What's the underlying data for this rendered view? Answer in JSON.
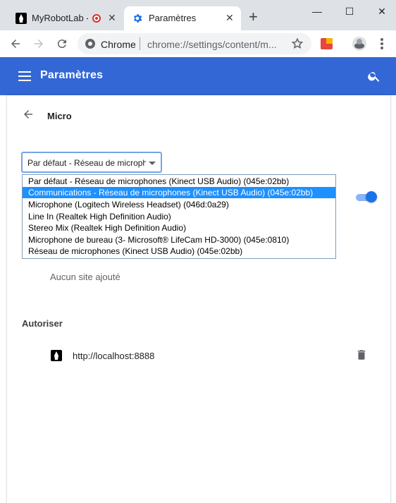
{
  "browser": {
    "tabs": [
      {
        "title": "MyRobotLab -",
        "icon": "myrobotlab-icon",
        "recording": true
      },
      {
        "title": "Paramètres",
        "icon": "settings-gear-icon",
        "active": true
      }
    ],
    "new_tab_label": "+",
    "window_controls": {
      "minimize": "—",
      "maximize": "☐",
      "close": "✕"
    },
    "omnibox": {
      "scheme_label": "Chrome",
      "url": "chrome://settings/content/m..."
    }
  },
  "settings": {
    "header_title": "Paramètres",
    "subpage_title": "Micro",
    "selected_device": "Par défaut - Réseau de micropho",
    "device_options": [
      "Par défaut - Réseau de microphones (Kinect USB Audio) (045e:02bb)",
      "Communications - Réseau de microphones (Kinect USB Audio) (045e:02bb)",
      "Microphone (Logitech Wireless Headset) (046d:0a29)",
      "Line In (Realtek High Definition Audio)",
      "Stereo Mix (Realtek High Definition Audio)",
      "Microphone de bureau (3- Microsoft® LifeCam HD-3000) (045e:0810)",
      "Réseau de microphones (Kinect USB Audio) (045e:02bb)"
    ],
    "highlighted_option_index": 1,
    "ask_toggle_on": true,
    "block_empty_text": "Aucun site ajouté",
    "allow_heading": "Autoriser",
    "allowed_site": "http://localhost:8888"
  },
  "colors": {
    "header_blue": "#3367d6",
    "toggle_blue": "#1a73e8",
    "highlight": "#1e90ff"
  }
}
